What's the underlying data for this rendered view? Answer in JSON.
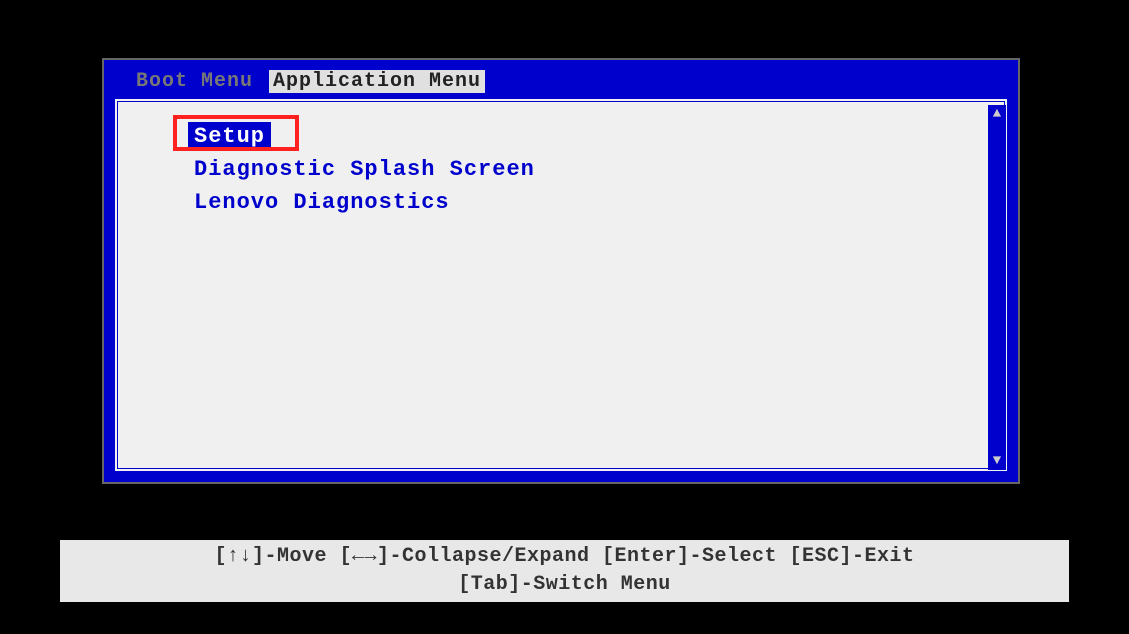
{
  "tabs": {
    "boot_menu": "Boot Menu",
    "application_menu": "Application Menu"
  },
  "active_tab": "application_menu",
  "menu": {
    "items": [
      {
        "label": "Setup",
        "selected": true
      },
      {
        "label": "Diagnostic Splash Screen",
        "selected": false
      },
      {
        "label": "Lenovo Diagnostics",
        "selected": false
      }
    ]
  },
  "help": {
    "line1": "[↑↓]-Move [←→]-Collapse/Expand [Enter]-Select [ESC]-Exit",
    "line2": "[Tab]-Switch Menu"
  }
}
